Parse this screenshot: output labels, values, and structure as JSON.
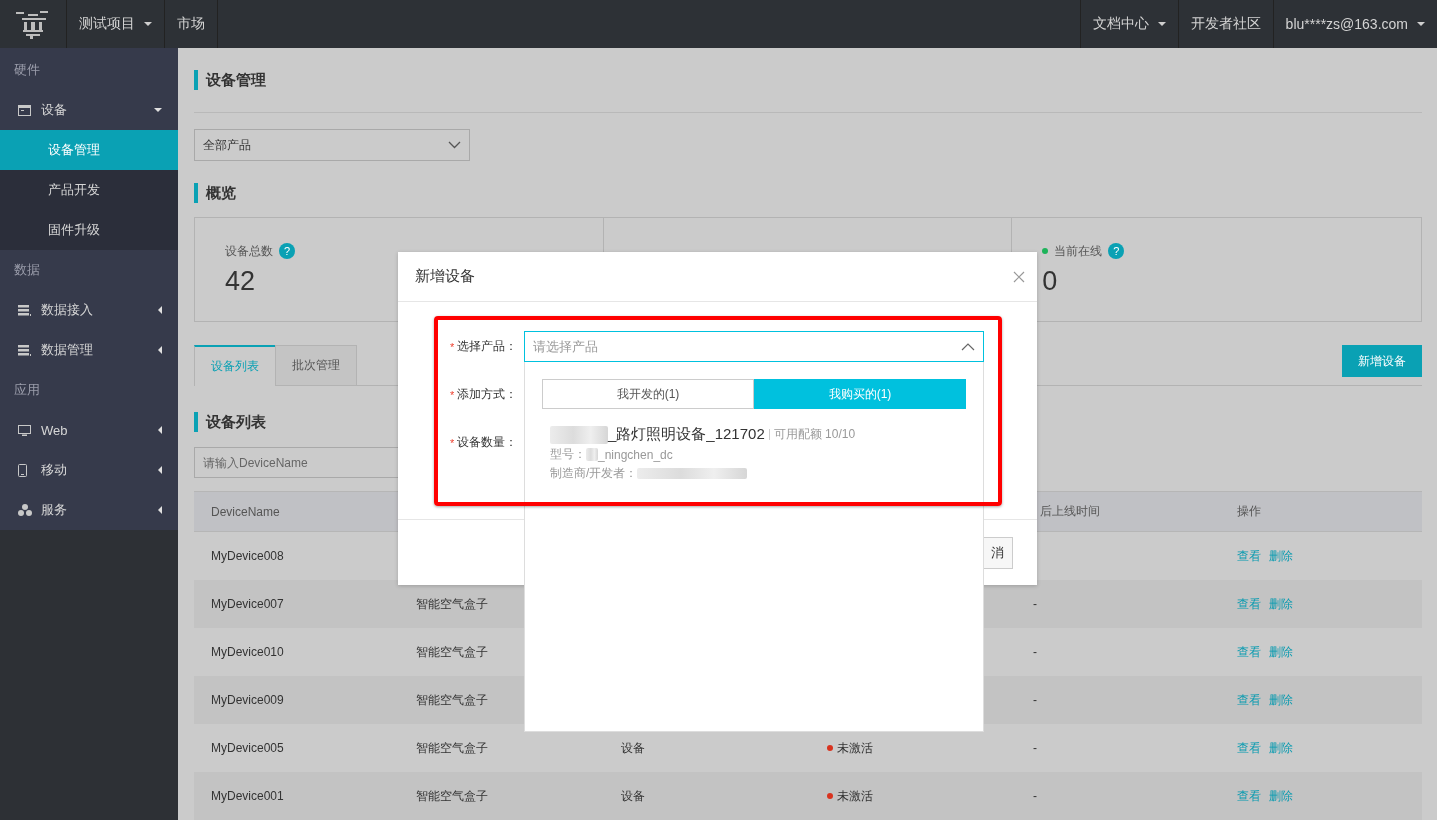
{
  "topbar": {
    "nav": [
      {
        "label": "测试项目",
        "dropdown": true
      },
      {
        "label": "市场",
        "dropdown": false
      }
    ],
    "links": [
      {
        "label": "文档中心",
        "dropdown": true
      },
      {
        "label": "开发者社区",
        "dropdown": false
      },
      {
        "label": "blu****zs@163.com",
        "dropdown": true
      }
    ]
  },
  "sidebar": {
    "sections": [
      {
        "title": "硬件",
        "items": [
          {
            "label": "设备",
            "expanded": true,
            "children": [
              {
                "label": "设备管理",
                "selected": true
              },
              {
                "label": "产品开发",
                "selected": false
              },
              {
                "label": "固件升级",
                "selected": false
              }
            ]
          }
        ]
      },
      {
        "title": "数据",
        "items": [
          {
            "label": "数据接入",
            "expanded": false
          },
          {
            "label": "数据管理",
            "expanded": false
          }
        ]
      },
      {
        "title": "应用",
        "items": [
          {
            "label": "Web",
            "expanded": false
          },
          {
            "label": "移动",
            "expanded": false
          },
          {
            "label": "服务",
            "expanded": false
          }
        ]
      }
    ]
  },
  "page": {
    "title": "设备管理",
    "product_filter": {
      "value": "全部产品"
    },
    "overview": {
      "title": "概览",
      "stats": [
        {
          "label": "设备总数",
          "value": "42",
          "help": "?"
        },
        {
          "label": "当前在线",
          "value": "0",
          "help": "?",
          "color": "#1db35a"
        }
      ]
    },
    "tabs": [
      {
        "label": "设备列表",
        "selected": true
      },
      {
        "label": "批次管理",
        "selected": false
      }
    ],
    "add_button": "新增设备",
    "device_list": {
      "title": "设备列表",
      "search": {
        "placeholder": "请输入DeviceName"
      },
      "table": {
        "header": {
          "name": "DeviceName",
          "last_online": "后上线时间",
          "actions": "操作"
        },
        "rows": [
          {
            "name": "MyDevice008",
            "actions": [
              "查看",
              "删除"
            ]
          },
          {
            "name": "MyDevice007",
            "product": "智能空气盒子",
            "last_online": "-",
            "actions": [
              "查看",
              "删除"
            ]
          },
          {
            "name": "MyDevice010",
            "product": "智能空气盒子",
            "last_online": "-",
            "actions": [
              "查看",
              "删除"
            ]
          },
          {
            "name": "MyDevice009",
            "product": "智能空气盒子",
            "last_online": "-",
            "actions": [
              "查看",
              "删除"
            ]
          },
          {
            "name": "MyDevice005",
            "product": "智能空气盒子",
            "column_3": "设备",
            "status": {
              "label": "未激活",
              "color": "#d9331f"
            },
            "last_online": "-",
            "actions": [
              "查看",
              "删除"
            ]
          },
          {
            "name": "MyDevice001",
            "product": "智能空气盒子",
            "column_3": "设备",
            "status": {
              "label": "未激活",
              "color": "#d9331f"
            },
            "last_online": "-",
            "actions": [
              "查看",
              "删除"
            ]
          }
        ]
      }
    }
  },
  "dialog": {
    "title": "新增设备",
    "required_mark": "*",
    "fields": [
      {
        "label": "选择产品：",
        "required": true
      },
      {
        "label": "添加方式：",
        "required": true
      },
      {
        "label": "设备数量：",
        "required": true
      }
    ],
    "product_select": {
      "placeholder": "请选择产品",
      "open": true
    },
    "cancel_button": "消",
    "dropdown": {
      "tabs": [
        {
          "label": "我开发的(1)",
          "selected": false
        },
        {
          "label": "我购买的(1)",
          "selected": true
        }
      ],
      "options": [
        {
          "name": "_路灯照明设备_121702",
          "quota": "可用配额 10/10",
          "model_label": "型号：",
          "model": "_ningchen_dc",
          "vendor_label": "制造商/开发者："
        }
      ]
    }
  }
}
